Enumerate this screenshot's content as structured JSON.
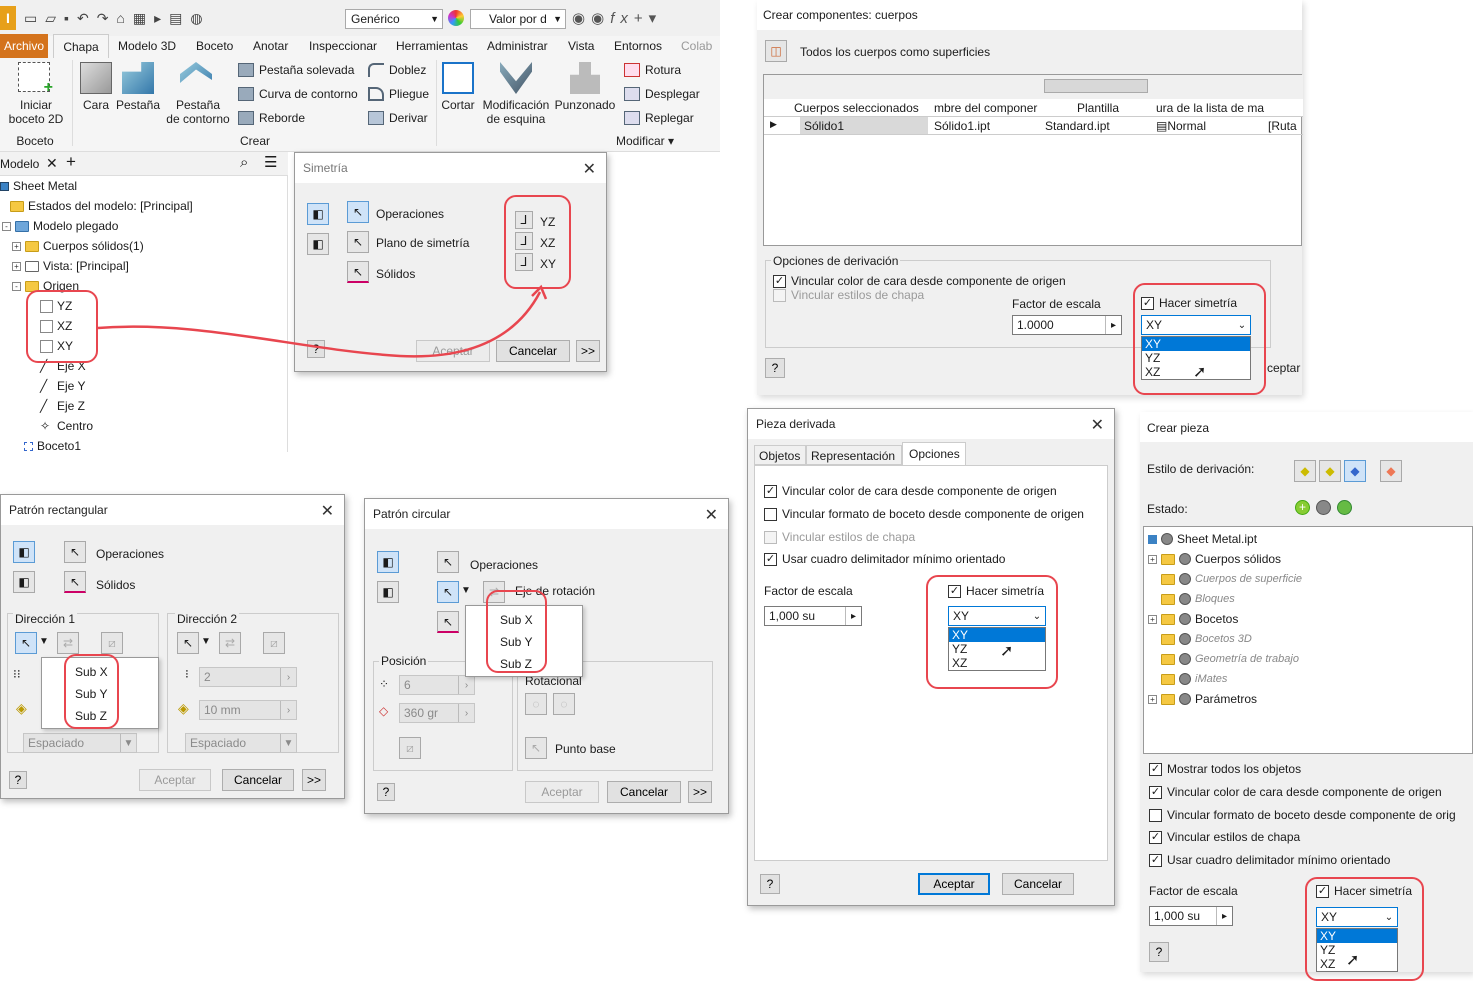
{
  "ribbon": {
    "style_select": "Genérico",
    "value_select": "Valor por d",
    "tabs": [
      "Archivo",
      "Chapa",
      "Modelo 3D",
      "Boceto",
      "Anotar",
      "Inspeccionar",
      "Herramientas",
      "Administrar",
      "Vista",
      "Entornos",
      "Colab"
    ],
    "sketch_button": "Iniciar\nboceto 2D",
    "group_sketch": "Boceto",
    "group_create": "Crear",
    "group_modify": "Modificar",
    "create": [
      "Cara",
      "Pestaña",
      "Pestaña\nde contorno"
    ],
    "small": [
      "Pestaña solevada",
      "Curva de contorno",
      "Reborde",
      "Doblez",
      "Pliegue",
      "Derivar"
    ],
    "modify": [
      "Cortar",
      "Modificación\nde esquina",
      "Punzonado"
    ],
    "modify_small": [
      "Rotura",
      "Desplegar",
      "Replegar"
    ]
  },
  "browser": {
    "tab": "Modelo",
    "items": [
      "Sheet Metal",
      "Estados del modelo: [Principal]",
      "Modelo plegado",
      "Cuerpos sólidos(1)",
      "Vista: [Principal]",
      "Origen",
      "YZ",
      "XZ",
      "XY",
      "Eje X",
      "Eje Y",
      "Eje Z",
      "Centro",
      "Boceto1"
    ]
  },
  "simetria": {
    "title": "Simetría",
    "ops": "Operaciones",
    "plane": "Plano de simetría",
    "solids": "Sólidos",
    "planes": [
      "YZ",
      "XZ",
      "XY"
    ],
    "ok": "Aceptar",
    "cancel": "Cancelar",
    "more": ">>",
    "help": "?"
  },
  "rect": {
    "title": "Patrón rectangular",
    "ops": "Operaciones",
    "solids": "Sólidos",
    "dir1": "Dirección 1",
    "dir2": "Dirección 2",
    "menu": [
      "Sub X",
      "Sub Y",
      "Sub Z"
    ],
    "count": "2",
    "dist": "10 mm",
    "spacing1": "Espaciado",
    "spacing2": "Espaciado",
    "ok": "Aceptar",
    "cancel": "Cancelar",
    "more": ">>",
    "help": "?"
  },
  "circ": {
    "title": "Patrón circular",
    "ops": "Operaciones",
    "axis": "Eje de rotación",
    "menu": [
      "Sub X",
      "Sub Y",
      "Sub Z"
    ],
    "position": "Posición",
    "count": "6",
    "angle": "360 gr",
    "rotational": "Rotacional",
    "base": "Punto base",
    "ok": "Aceptar",
    "cancel": "Cancelar",
    "more": ">>",
    "help": "?"
  },
  "cuerpos": {
    "title": "Crear componentes: cuerpos",
    "all_surfaces": "Todos los cuerpos como superficies",
    "columns": [
      "Cuerpos seleccionados",
      "mbre del componer",
      "Plantilla",
      "ura de la lista de ma"
    ],
    "row": [
      "Sólido1",
      "Sólido1.ipt",
      "Standard.ipt",
      "Normal",
      "[Ruta"
    ],
    "options": "Opciones de derivación",
    "link_color": "Vincular color de cara desde componente de origen",
    "link_styles": "Vincular estilos de chapa",
    "scale_label": "Factor de escala",
    "scale": "1.0000",
    "mirror": "Hacer simetría",
    "selected": "XY",
    "list": [
      "XY",
      "YZ",
      "XZ"
    ],
    "ok_partial": "ceptar",
    "help": "?"
  },
  "derivada": {
    "title": "Pieza derivada",
    "tabs": [
      "Objetos",
      "Representación",
      "Opciones"
    ],
    "checks": [
      "Vincular color de cara desde componente de origen",
      "Vincular formato de boceto desde componente de origen",
      "Vincular estilos de chapa",
      "Usar cuadro delimitador mínimo orientado"
    ],
    "scale_label": "Factor de escala",
    "scale": "1,000 su",
    "mirror": "Hacer simetría",
    "selected": "XY",
    "list": [
      "XY",
      "YZ",
      "XZ"
    ],
    "ok": "Aceptar",
    "cancel": "Cancelar",
    "help": "?"
  },
  "pieza": {
    "title": "Crear pieza",
    "style": "Estilo de derivación:",
    "state": "Estado:",
    "tree": [
      "Sheet Metal.ipt",
      "Cuerpos sólidos",
      "Cuerpos de superficie",
      "Bloques",
      "Bocetos",
      "Bocetos 3D",
      "Geometría de trabajo",
      "iMates",
      "Parámetros"
    ],
    "checks": [
      "Mostrar todos los objetos",
      "Vincular color de cara desde componente de origen",
      "Vincular formato de boceto desde componente de orig",
      "Vincular estilos de chapa",
      "Usar cuadro delimitador mínimo orientado"
    ],
    "scale_label": "Factor de escala",
    "scale": "1,000 su",
    "mirror": "Hacer simetría",
    "selected": "XY",
    "list": [
      "XY",
      "YZ",
      "XZ"
    ],
    "help": "?"
  },
  "colors": {
    "accent": "#e8464f",
    "selection": "#0078d7",
    "archivo": "#d4731c"
  }
}
